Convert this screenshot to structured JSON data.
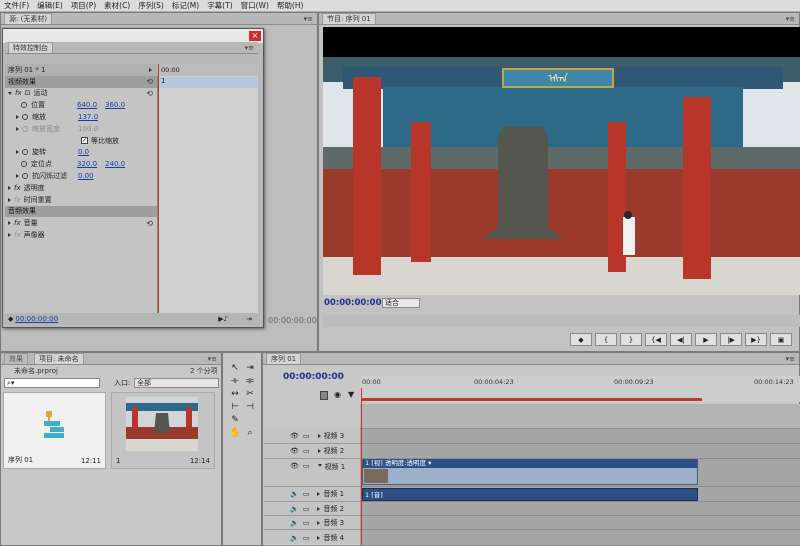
{
  "menubar": [
    "文件(F)",
    "编辑(E)",
    "项目(P)",
    "素材(C)",
    "序列(S)",
    "标记(M)",
    "字幕(T)",
    "窗口(W)",
    "帮助(H)"
  ],
  "source": {
    "tab": "源: (无素材)",
    "timecode": "00:00:00:00"
  },
  "effect_controls": {
    "tab": "特效控制台",
    "sequence_label": "序列 01 * 1",
    "ruler_start": "00:00",
    "clip_label": "1",
    "video_effects": "视频效果",
    "motion": "运动",
    "position": "位置",
    "position_x": "640.0",
    "position_y": "360.0",
    "scale": "缩放",
    "scale_val": "137.0",
    "scale_width": "缩放宽度",
    "scale_width_val": "100.0",
    "uniform_scale": "等比缩放",
    "rotation": "旋转",
    "rotation_val": "0.0",
    "anchor": "定位点",
    "anchor_x": "320.0",
    "anchor_y": "240.0",
    "anti_flicker": "抗闪烁过滤",
    "anti_flicker_val": "0.00",
    "opacity": "透明度",
    "time_remap": "时间重置",
    "audio_effects": "音频效果",
    "volume": "音量",
    "panner": "声像器",
    "timecode": "00:00:00:00"
  },
  "program": {
    "tab": "节目: 序列 01",
    "timecode": "00:00:00:00",
    "fit": "适合"
  },
  "project": {
    "tabs": [
      "效果",
      "项目: 未命名"
    ],
    "name": "未命名.prproj",
    "count": "2 个分项",
    "search_placeholder": "",
    "in_label": "入口:",
    "in_value": "全部",
    "items": [
      {
        "name": "序列 01",
        "duration": "12:11"
      },
      {
        "name": "1",
        "duration": "12:14"
      }
    ]
  },
  "timeline": {
    "tab": "序列 01",
    "timecode": "00:00:00:00",
    "ruler": [
      "00:00",
      "00:00:04:23",
      "00:00:09:23",
      "00:00:14:23"
    ],
    "video_tracks": [
      "视频 3",
      "视频 2",
      "视频 1"
    ],
    "audio_tracks": [
      "音频 1",
      "音频 2",
      "音频 3",
      "音频 4"
    ],
    "video_clip": "1 [视] 透明度:透明度 ▾",
    "audio_clip": "1 [音]"
  },
  "colors": {
    "accent_blue": "#1a2f8a",
    "playhead": "#c0392b",
    "clip_video": "#2e4e86"
  }
}
